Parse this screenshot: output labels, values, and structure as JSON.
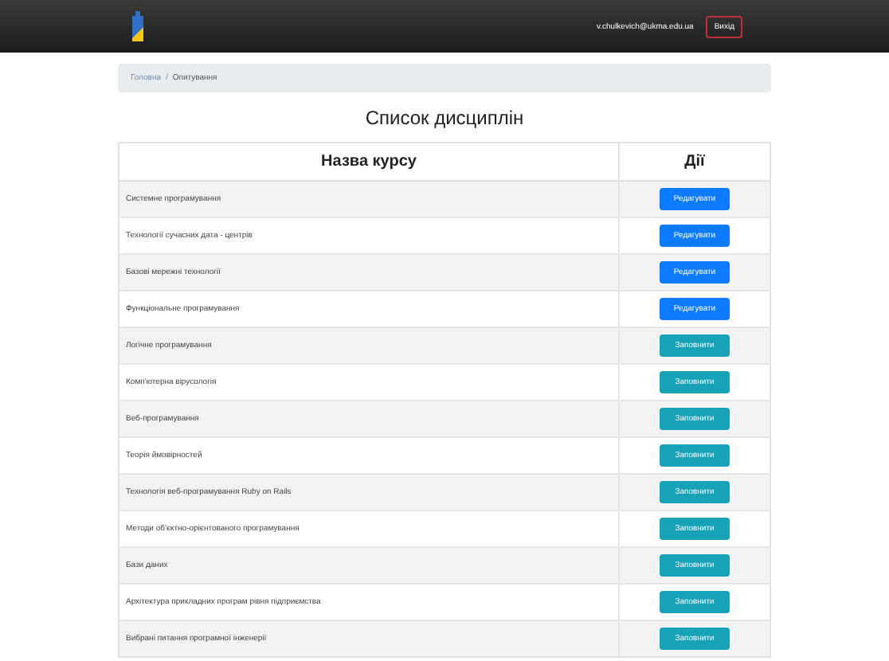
{
  "navbar": {
    "user_email": "v.chulkevich@ukma.edu.ua",
    "logout_button": "Вихід"
  },
  "breadcrumb": [
    {
      "label": "Головна",
      "current": false
    },
    {
      "label": "Опитування",
      "current": true
    }
  ],
  "breadcrumb_separator": "/",
  "title": "Список дисциплін",
  "table": {
    "columns": [
      "Назва курсу",
      "Дії"
    ],
    "rows": [
      {
        "name": "Системне програмування",
        "action": "Редагувати",
        "kind": "edit"
      },
      {
        "name": "Технології сучасних дата - центрів",
        "action": "Редагувати",
        "kind": "edit"
      },
      {
        "name": "Базові мережні технології",
        "action": "Редагувати",
        "kind": "edit"
      },
      {
        "name": "Функціональне програмування",
        "action": "Редагувати",
        "kind": "edit"
      },
      {
        "name": "Логічне програмування",
        "action": "Заповнити",
        "kind": "fill"
      },
      {
        "name": "Комп'ютерна вірусологія",
        "action": "Заповнити",
        "kind": "fill"
      },
      {
        "name": "Веб-програмування",
        "action": "Заповнити",
        "kind": "fill"
      },
      {
        "name": "Теорія ймовірностей",
        "action": "Заповнити",
        "kind": "fill"
      },
      {
        "name": "Технологія веб-програмування Ruby on Rails",
        "action": "Заповнити",
        "kind": "fill"
      },
      {
        "name": "Методи об'єктно-орієнтованого програмування",
        "action": "Заповнити",
        "kind": "fill"
      },
      {
        "name": "Бази даних",
        "action": "Заповнити",
        "kind": "fill"
      },
      {
        "name": "Архітектура прикладних програм рівня підприємства",
        "action": "Заповнити",
        "kind": "fill"
      },
      {
        "name": "Вибрані питання програмної інженерії",
        "action": "Заповнити",
        "kind": "fill"
      }
    ]
  }
}
